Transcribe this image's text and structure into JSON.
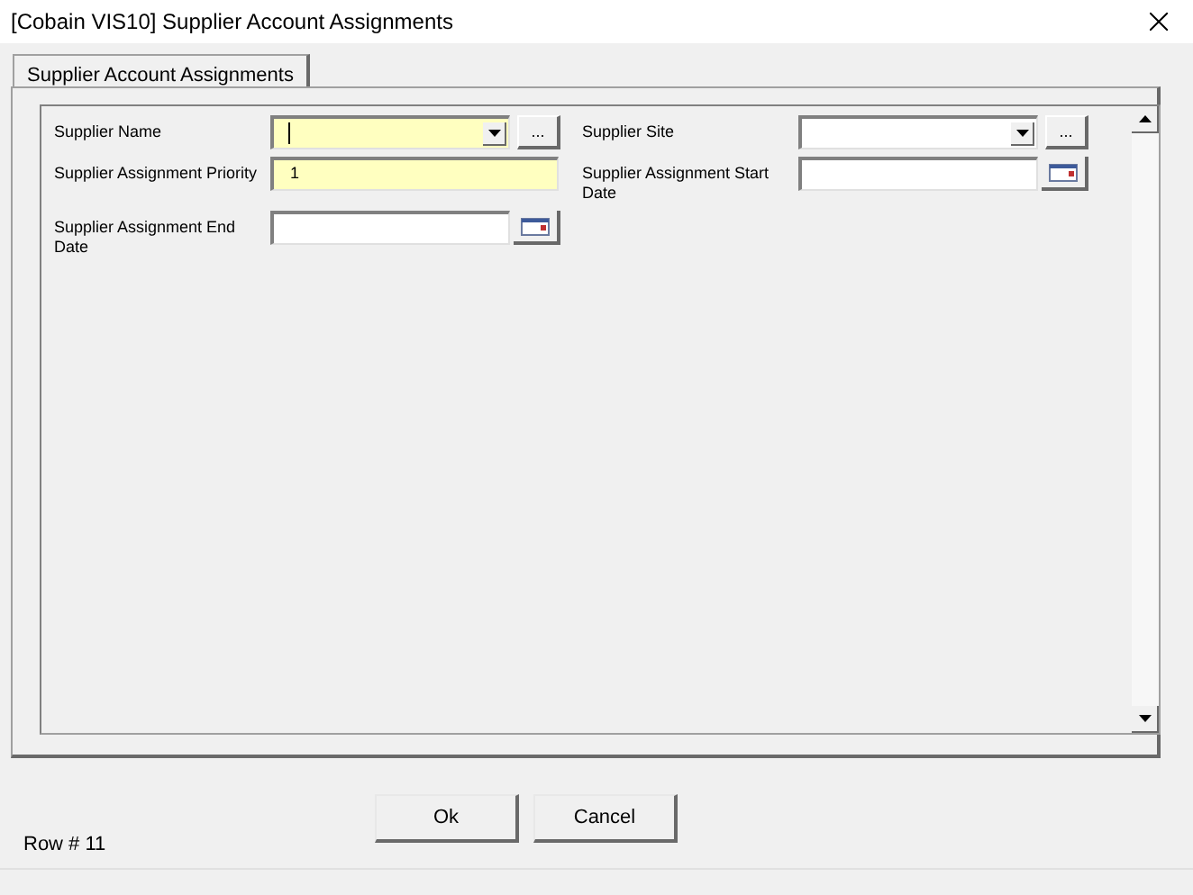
{
  "window": {
    "title": "[Cobain VIS10] Supplier Account Assignments"
  },
  "tabs": [
    {
      "label": "Supplier Account Assignments",
      "selected": true
    }
  ],
  "fields": [
    {
      "label": "Supplier Name",
      "kind": "combo",
      "required": true,
      "focused": true,
      "button": "..."
    },
    {
      "label": "Supplier Site",
      "kind": "combo",
      "required": false,
      "focused": false,
      "button": "..."
    },
    {
      "label": "Supplier Assignment Priority",
      "kind": "text",
      "value": "1",
      "required": true,
      "focused": false
    },
    {
      "label": "Supplier Assignment Start Date",
      "kind": "date",
      "required": false,
      "focused": false
    },
    {
      "label": "Supplier Assignment End Date",
      "kind": "date",
      "required": false,
      "focused": false
    }
  ],
  "status": "Row # 11",
  "buttons": [
    "Ok",
    "Cancel"
  ]
}
